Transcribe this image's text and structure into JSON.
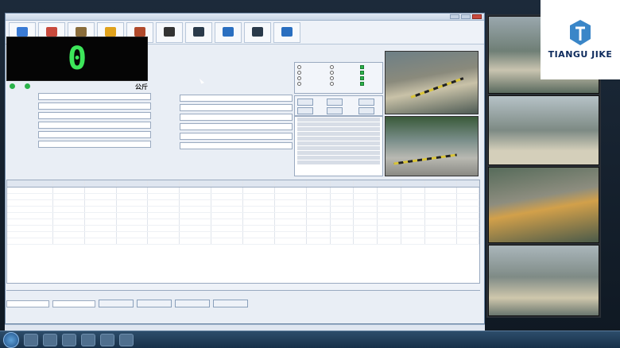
{
  "window": {
    "title": ""
  },
  "menu": {
    "items": [
      "",
      "",
      "",
      "",
      "",
      ""
    ]
  },
  "toolbar": {
    "buttons": [
      {
        "label": "",
        "icon": "add-icon",
        "color": "#3a7bd5"
      },
      {
        "label": "",
        "icon": "user-icon",
        "color": "#c84a3d"
      },
      {
        "label": "",
        "icon": "scale-icon",
        "color": "#8a6d3b"
      },
      {
        "label": "",
        "icon": "chart-icon",
        "color": "#e0a21c"
      },
      {
        "label": "",
        "icon": "tools-icon",
        "color": "#b04a2c"
      },
      {
        "label": "",
        "icon": "camera-icon",
        "color": "#333333"
      },
      {
        "label": "",
        "icon": "calculator-icon",
        "color": "#2a3a4a"
      },
      {
        "label": "",
        "icon": "network-icon",
        "color": "#2a6fc0"
      },
      {
        "label": "",
        "icon": "microphone-icon",
        "color": "#2a3a4a"
      },
      {
        "label": "",
        "icon": "phone-icon",
        "color": "#2a6fc0"
      }
    ]
  },
  "weight": {
    "value": "0",
    "unit": "公斤"
  },
  "status": {
    "left": "",
    "right": ""
  },
  "form_left": {
    "fields": [
      {
        "label": "",
        "value": ""
      },
      {
        "label": "",
        "value": ""
      },
      {
        "label": "",
        "value": ""
      },
      {
        "label": "",
        "value": ""
      },
      {
        "label": "",
        "value": ""
      },
      {
        "label": "",
        "value": ""
      }
    ]
  },
  "form_right": {
    "fields": [
      {
        "label": "",
        "value": ""
      },
      {
        "label": "",
        "value": ""
      },
      {
        "label": "",
        "value": ""
      },
      {
        "label": "",
        "value": ""
      },
      {
        "label": "",
        "value": ""
      },
      {
        "label": "",
        "value": ""
      }
    ]
  },
  "stats": {
    "text": ""
  },
  "table": {
    "headers": [
      "",
      "",
      "",
      "",
      "",
      "",
      "",
      "",
      "",
      "",
      "",
      "",
      "",
      "",
      "",
      ""
    ],
    "rows": [
      [
        "",
        "",
        "",
        "",
        "",
        "",
        "",
        "",
        "",
        "",
        "",
        "",
        "",
        "",
        "",
        ""
      ],
      [
        "",
        "",
        "",
        "",
        "",
        "",
        "",
        "",
        "",
        "",
        "",
        "",
        "",
        "",
        "",
        ""
      ],
      [
        "",
        "",
        "",
        "",
        "",
        "",
        "",
        "",
        "",
        "",
        "",
        "",
        "",
        "",
        "",
        ""
      ],
      [
        "",
        "",
        "",
        "",
        "",
        "",
        "",
        "",
        "",
        "",
        "",
        "",
        "",
        "",
        "",
        ""
      ],
      [
        "",
        "",
        "",
        "",
        "",
        "",
        "",
        "",
        "",
        "",
        "",
        "",
        "",
        "",
        "",
        ""
      ],
      [
        "",
        "",
        "",
        "",
        "",
        "",
        "",
        "",
        "",
        "",
        "",
        "",
        "",
        "",
        "",
        ""
      ],
      [
        "",
        "",
        "",
        "",
        "",
        "",
        "",
        "",
        "",
        "",
        "",
        "",
        "",
        "",
        "",
        ""
      ],
      [
        "",
        "",
        "",
        "",
        "",
        "",
        "",
        "",
        "",
        "",
        "",
        "",
        "",
        "",
        "",
        ""
      ],
      [
        "",
        "",
        "",
        "",
        "",
        "",
        "",
        "",
        "",
        "",
        "",
        "",
        "",
        "",
        "",
        ""
      ]
    ],
    "totals": [
      "",
      "",
      "",
      ""
    ]
  },
  "bottom": {
    "selects": [
      "",
      ""
    ],
    "buttons": [
      "",
      "",
      "",
      ""
    ]
  },
  "statusbar": {
    "left": "",
    "right": ""
  },
  "logo": {
    "name": "TIANGU JIKE",
    "sub": ""
  },
  "clock": {
    "time": "",
    "date": ""
  },
  "colors": {
    "weight_green": "#3de65a",
    "status_green": "#2bb34a",
    "logo_blue": "#0d2a5c"
  }
}
